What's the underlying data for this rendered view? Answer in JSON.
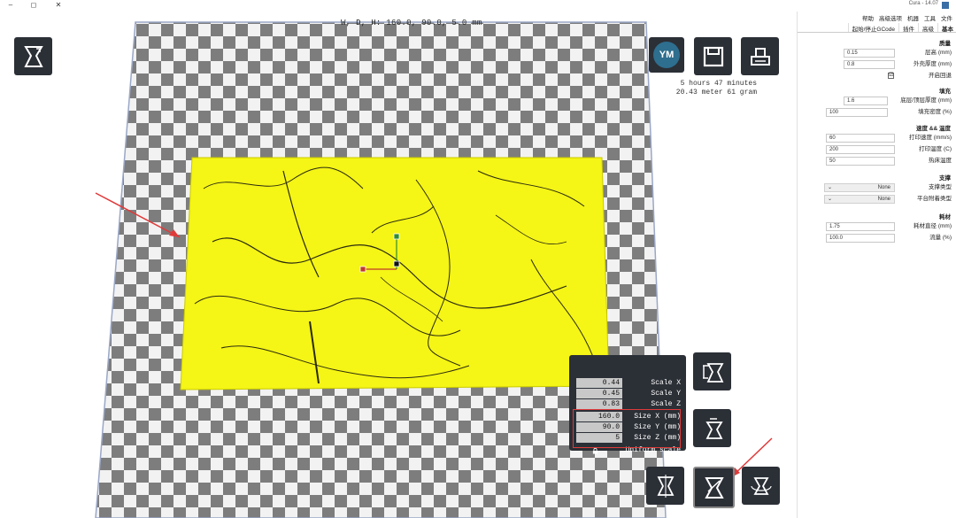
{
  "window": {
    "title": "Cura - 14.07",
    "minimize_glyph": "–",
    "maximize_glyph": "◻",
    "close_glyph": "✕"
  },
  "viewport": {
    "dimensions_label": "W, D, H: 160.0, 90.0, 5.0 mm",
    "avatar_initials": "YM",
    "print_time": "5 hours 47 minutes",
    "print_material": "20.43 meter 61 gram",
    "colors": {
      "accent_yellow": "#f5f516",
      "checker_dark": "#7d7d7d",
      "checker_light": "#f2f2f2",
      "panel_dark": "#2b2f36",
      "annotation_red": "#e03a3a"
    }
  },
  "scale_panel": {
    "rows": [
      {
        "label": "Scale X",
        "value": "0.44"
      },
      {
        "label": "Scale Y",
        "value": "0.45"
      },
      {
        "label": "Scale Z",
        "value": "0.83"
      },
      {
        "label": "Size X (mm)",
        "value": "160.0"
      },
      {
        "label": "Size Y (mm)",
        "value": "90.0"
      },
      {
        "label": "Size Z (mm)",
        "value": "5"
      }
    ],
    "uniform_label": "Uniform scale"
  },
  "panel": {
    "menu": [
      "文件",
      "工具",
      "机器",
      "高级选项",
      "帮助"
    ],
    "tabs": [
      "基本",
      "高级",
      "插件",
      "起始/停止GCode"
    ],
    "sections": {
      "quality": {
        "title": "质量",
        "fields": [
          {
            "label": "层高 (mm)",
            "value": "0.15"
          },
          {
            "label": "外壳厚度 (mm)",
            "value": "0.8"
          },
          {
            "label": "开启回退",
            "value": "☑"
          }
        ]
      },
      "fill": {
        "title": "填充",
        "fields": [
          {
            "label": "底层/顶层厚度 (mm)",
            "value": "1.6"
          },
          {
            "label": "填充密度 (%)",
            "value": "100"
          }
        ]
      },
      "speed": {
        "title": "速度 && 温度",
        "fields": [
          {
            "label": "打印速度 (mm/s)",
            "value": "60"
          },
          {
            "label": "打印温度 (C)",
            "value": "200"
          },
          {
            "label": "热床温度",
            "value": "50"
          }
        ]
      },
      "support": {
        "title": "支撑",
        "fields": [
          {
            "label": "支撑类型",
            "value": "None"
          },
          {
            "label": "平台附着类型",
            "value": "None"
          }
        ]
      },
      "filament": {
        "title": "耗材",
        "fields": [
          {
            "label": "耗材直径 (mm)",
            "value": "1.75"
          },
          {
            "label": "流量 (%)",
            "value": "100.0"
          }
        ]
      }
    }
  }
}
